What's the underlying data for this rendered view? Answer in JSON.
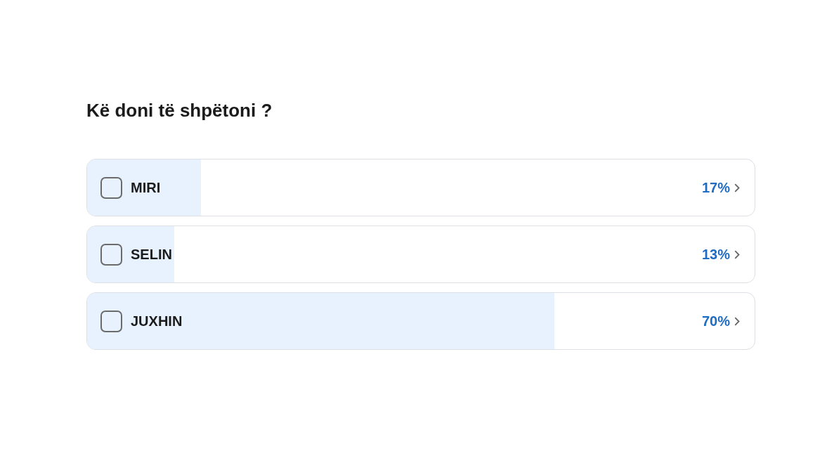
{
  "question": "Kë doni të shpëtoni ?",
  "options": [
    {
      "label": "MIRI",
      "checked": false,
      "level": 0.17,
      "percent": "17%"
    },
    {
      "label": "SELIN",
      "checked": false,
      "level": 0.13,
      "percent": "13%"
    },
    {
      "label": "JUXHIN",
      "checked": false,
      "level": 0.7,
      "percent": "70%"
    }
  ]
}
